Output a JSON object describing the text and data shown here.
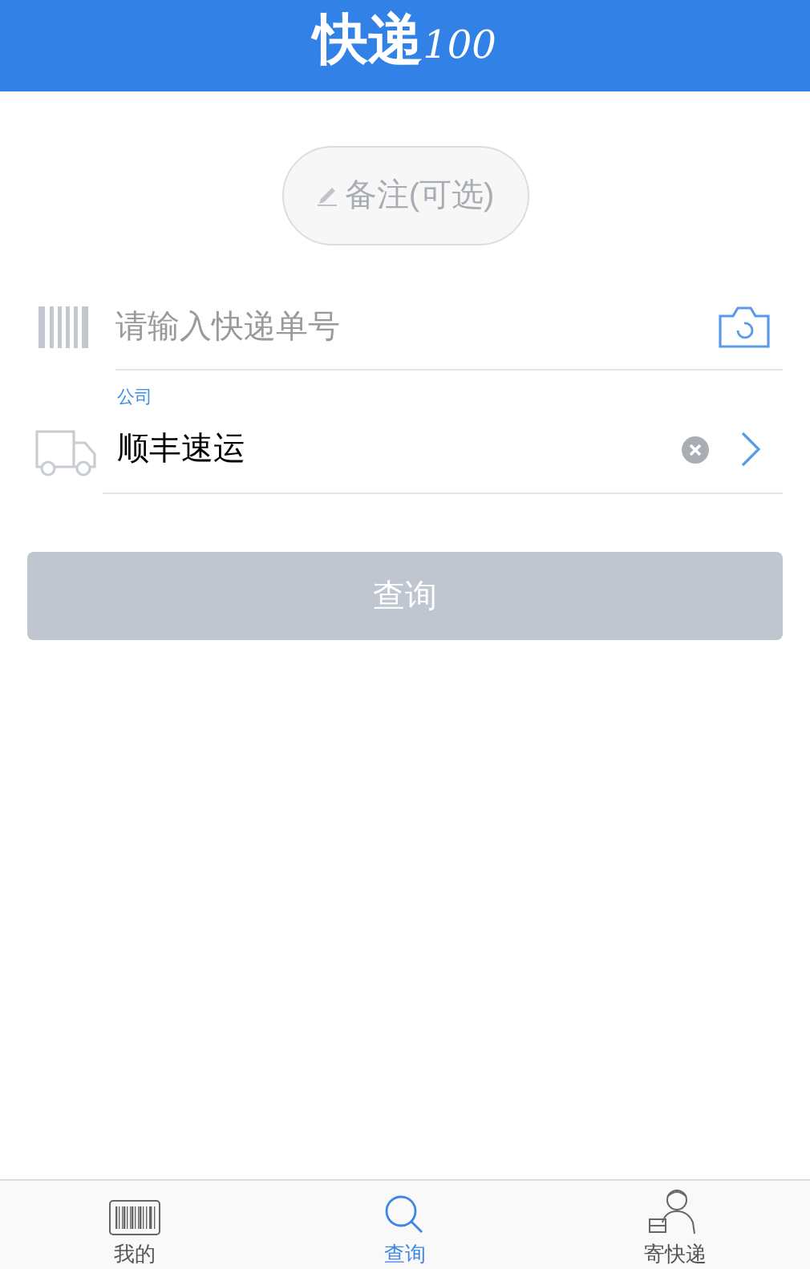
{
  "header": {
    "logo_text": "快递",
    "logo_mark": "100"
  },
  "note_button": {
    "label": "备注(可选)"
  },
  "tracking_field": {
    "placeholder": "请输入快递单号"
  },
  "company_field": {
    "label": "公司",
    "value": "顺丰速运"
  },
  "query_button": {
    "label": "查询",
    "disabled": true
  },
  "tab_bar": [
    {
      "label": "我的",
      "kind": "barcode",
      "selected": false
    },
    {
      "label": "查询",
      "kind": "search",
      "selected": true
    },
    {
      "label": "寄快递",
      "kind": "courier",
      "selected": false
    }
  ]
}
